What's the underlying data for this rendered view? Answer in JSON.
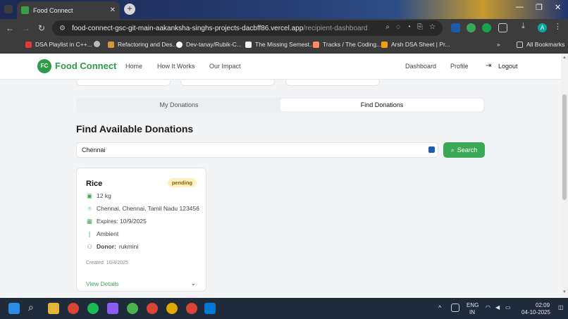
{
  "browser": {
    "tab_title": "Food Connect",
    "url_host": "food-connect-gsc-git-main-aakanksha-singhs-projects-dacbff86.vercel.app",
    "url_path": "/recipient-dashboard",
    "bookmarks": [
      {
        "label": "DSA Playlist in C++...",
        "color": "#e53935"
      },
      {
        "label": "",
        "color": "#bbbbbb"
      },
      {
        "label": "Refactoring and Des...",
        "color": "#d49a3a"
      },
      {
        "label": "Dev-tanay/Rubik-C...",
        "color": "#ffffff"
      },
      {
        "label": "The Missing Semest...",
        "color": "#f2f2f2"
      },
      {
        "label": "Tracks / The Coding...",
        "color": "#ff8a65"
      },
      {
        "label": "Arsh DSA Sheet | Pr...",
        "color": "#f59e0b"
      }
    ],
    "all_bookmarks": "All Bookmarks",
    "profile_initial": "A"
  },
  "site": {
    "logo_initials": "FC",
    "logo_text": "Food Connect",
    "nav": [
      "Home",
      "How It Works",
      "Our Impact"
    ],
    "dashboard": "Dashboard",
    "profile": "Profile",
    "logout": "Logout"
  },
  "tabs": {
    "my_donations": "My Donations",
    "find_donations": "Find Donations",
    "active": "find_donations"
  },
  "find": {
    "title": "Find Available Donations",
    "search_value": "Chennai",
    "search_button": "Search"
  },
  "card": {
    "title": "Rice",
    "status": "pending",
    "quantity": "12 kg",
    "location": "Chennai, Chennai, Tamil Nadu 123456",
    "expires": "Expires: 10/9/2025",
    "storage": "Ambient",
    "donor_label": "Donor:",
    "donor_name": "rukmini",
    "created": "Created: 10/4/2025",
    "view_details": "View Details"
  },
  "taskbar": {
    "lang": "ENG",
    "region": "IN",
    "time": "02:09",
    "date": "04-10-2025"
  },
  "colors": {
    "brand_green": "#2f9a48",
    "button_green": "#3aa857",
    "badge_bg": "#fdf0c2"
  }
}
